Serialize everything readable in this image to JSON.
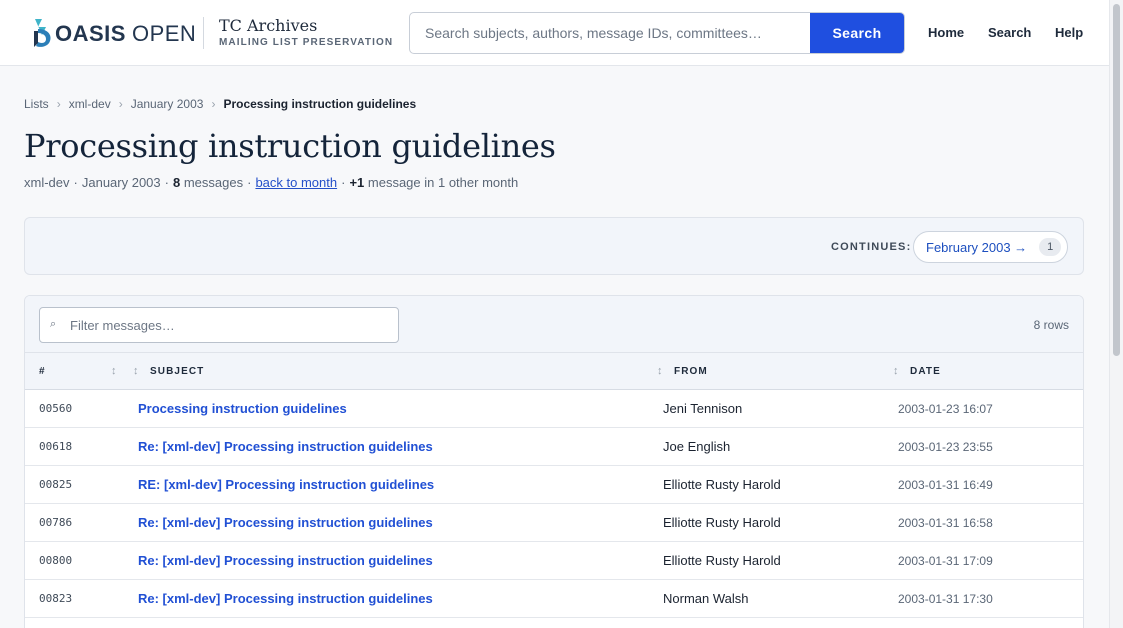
{
  "header": {
    "logo_bold": "OASIS",
    "logo_light": "OPEN",
    "brand_title": "TC Archives",
    "brand_subtitle": "MAILING LIST PRESERVATION",
    "search_placeholder": "Search subjects, authors, message IDs, committees…",
    "search_button": "Search",
    "nav": [
      "Home",
      "Search",
      "Help"
    ]
  },
  "breadcrumb": [
    "Lists",
    "xml-dev",
    "January 2003",
    "Processing instruction guidelines"
  ],
  "thread": {
    "title": "Processing instruction guidelines",
    "list": "xml-dev",
    "month": "January 2003",
    "message_count": "8",
    "messages_word": "messages",
    "back_link": "back to month",
    "extra_count": "+1",
    "extra_text": "message in 1 other month"
  },
  "continues": {
    "label": "CONTINUES:",
    "month": "February 2003 →",
    "count": "1"
  },
  "table": {
    "filter_placeholder": "Filter messages…",
    "row_count": "8 rows",
    "columns": [
      "#",
      "SUBJECT",
      "FROM",
      "DATE"
    ],
    "rows": [
      {
        "num": "00560",
        "subject": "Processing instruction guidelines",
        "from": "Jeni Tennison",
        "date": "2003-01-23 16:07"
      },
      {
        "num": "00618",
        "subject": "Re: [xml-dev] Processing instruction guidelines",
        "from": "Joe English",
        "date": "2003-01-23 23:55"
      },
      {
        "num": "00825",
        "subject": "RE: [xml-dev] Processing instruction guidelines",
        "from": "Elliotte Rusty Harold",
        "date": "2003-01-31 16:49"
      },
      {
        "num": "00786",
        "subject": "Re: [xml-dev] Processing instruction guidelines",
        "from": "Elliotte Rusty Harold",
        "date": "2003-01-31 16:58"
      },
      {
        "num": "00800",
        "subject": "Re: [xml-dev] Processing instruction guidelines",
        "from": "Elliotte Rusty Harold",
        "date": "2003-01-31 17:09"
      },
      {
        "num": "00823",
        "subject": "Re: [xml-dev] Processing instruction guidelines",
        "from": "Norman Walsh",
        "date": "2003-01-31 17:30"
      }
    ]
  },
  "colors": {
    "accent": "#1f4fe0",
    "link": "#2150d4",
    "logo_teal": "#3fb4c9",
    "logo_navy": "#23364f"
  }
}
